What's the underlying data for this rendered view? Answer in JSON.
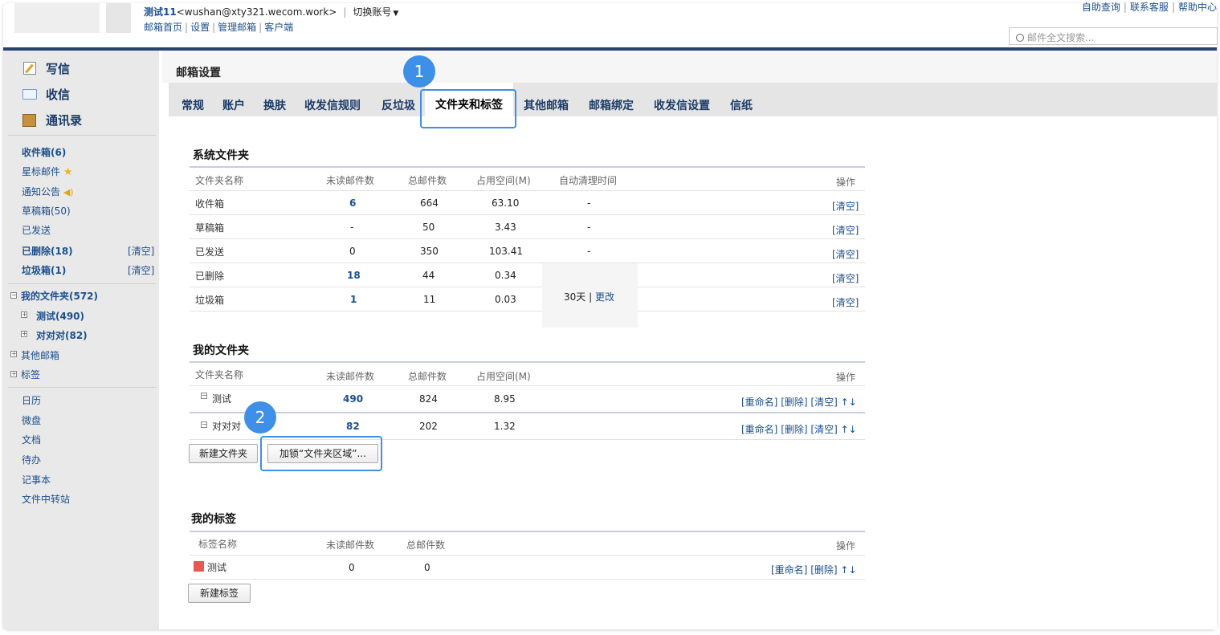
{
  "header": {
    "user_name": "测试11",
    "user_email": "<wushan@xty321.wecom.work>",
    "sep": "|",
    "switch_account": "切换账号",
    "nav": [
      "邮箱首页",
      "设置",
      "管理邮箱",
      "客户端"
    ],
    "top_links": [
      "自助查询",
      "联系客服",
      "帮助中心"
    ],
    "search_placeholder": "邮件全文搜索..."
  },
  "sidebar": {
    "write": "写信",
    "receive": "收信",
    "contacts": "通讯录",
    "inbox": "收件箱(6)",
    "starred": "星标邮件",
    "notice": "通知公告",
    "drafts": "草稿箱(50)",
    "sent": "已发送",
    "deleted": "已删除(18)",
    "spam": "垃圾箱(1)",
    "clear": "[清空]",
    "my_folders": "我的文件夹(572)",
    "folder_test": "测试(490)",
    "folder_ddd": "对对对(82)",
    "other_mailbox": "其他邮箱",
    "tags": "标签",
    "tools": [
      "日历",
      "微盘",
      "文档",
      "待办",
      "记事本",
      "文件中转站"
    ]
  },
  "page": {
    "title": "邮箱设置",
    "tabs": [
      "常规",
      "账户",
      "换肤",
      "收发信规则",
      "反垃圾",
      "文件夹和标签",
      "其他邮箱",
      "邮箱绑定",
      "收发信设置",
      "信纸"
    ],
    "active_tab": "文件夹和标签"
  },
  "callouts": {
    "one": "1",
    "two": "2"
  },
  "system_folders": {
    "title": "系统文件夹",
    "headers": [
      "文件夹名称",
      "未读邮件数",
      "总邮件数",
      "占用空间(M)",
      "自动清理时间",
      "操作"
    ],
    "rows": [
      {
        "name": "收件箱",
        "unread": "6",
        "total": "664",
        "size": "63.10",
        "auto": "-",
        "op": "[清空]"
      },
      {
        "name": "草稿箱",
        "unread": "-",
        "total": "50",
        "size": "3.43",
        "auto": "-",
        "op": "[清空]"
      },
      {
        "name": "已发送",
        "unread": "0",
        "total": "350",
        "size": "103.41",
        "auto": "-",
        "op": "[清空]"
      },
      {
        "name": "已删除",
        "unread": "18",
        "total": "44",
        "size": "0.34",
        "auto": "",
        "op": "[清空]"
      },
      {
        "name": "垃圾箱",
        "unread": "1",
        "total": "11",
        "size": "0.03",
        "auto": "",
        "op": "[清空]"
      }
    ],
    "auto_clean_days": "30天",
    "auto_clean_sep": "|",
    "auto_clean_change": "更改"
  },
  "my_folders": {
    "title": "我的文件夹",
    "headers": [
      "文件夹名称",
      "未读邮件数",
      "总邮件数",
      "占用空间(M)",
      "操作"
    ],
    "rows": [
      {
        "name": "测试",
        "unread": "490",
        "total": "824",
        "size": "8.95"
      },
      {
        "name": "对对对",
        "unread": "82",
        "total": "202",
        "size": "1.32"
      }
    ],
    "ops": {
      "rename": "[重命名]",
      "delete": "[删除]",
      "clear": "[清空]",
      "up": "↑",
      "down": "↓"
    },
    "new_folder_button": "新建文件夹",
    "lock_button": "加锁“文件夹区域”..."
  },
  "my_tags": {
    "title": "我的标签",
    "headers": [
      "标签名称",
      "未读邮件数",
      "总邮件数",
      "操作"
    ],
    "rows": [
      {
        "name": "测试",
        "unread": "0",
        "total": "0",
        "color": "#e8594f"
      }
    ],
    "ops": {
      "rename": "[重命名]",
      "delete": "[删除]",
      "up": "↑",
      "down": "↓"
    },
    "new_tag_button": "新建标签"
  },
  "colors": {
    "link": "#1b4f8e",
    "topbar": "#29426e",
    "callout": "#3d8fe8",
    "tag": "#e8594f"
  }
}
